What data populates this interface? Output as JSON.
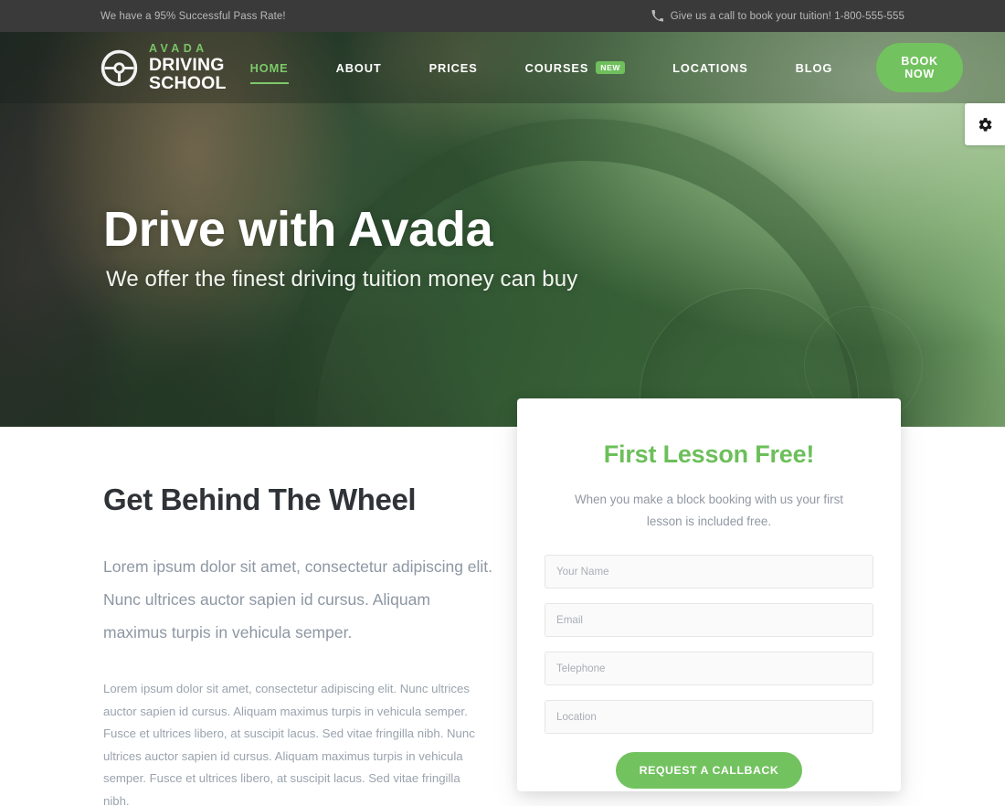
{
  "topbar": {
    "left_text": "We have a 95% Successful Pass Rate!",
    "phone_icon": "phone-icon",
    "right_text": "Give us a call to book your tuition! 1-800-555-555"
  },
  "header": {
    "logo": {
      "icon": "steering-wheel-icon",
      "top_line": "AVADA",
      "bottom_line": "DRIVING SCHOOL"
    },
    "nav": [
      {
        "label": "HOME",
        "active": true,
        "badge": ""
      },
      {
        "label": "ABOUT",
        "active": false,
        "badge": ""
      },
      {
        "label": "PRICES",
        "active": false,
        "badge": ""
      },
      {
        "label": "COURSES",
        "active": false,
        "badge": "NEW"
      },
      {
        "label": "LOCATIONS",
        "active": false,
        "badge": ""
      },
      {
        "label": "BLOG",
        "active": false,
        "badge": ""
      }
    ],
    "cta_label": "BOOK NOW"
  },
  "hero": {
    "title": "Drive with Avada",
    "subtitle": "We offer the finest driving tuition money can buy"
  },
  "settings_tab": {
    "icon": "gear-icon"
  },
  "main": {
    "section_title": "Get Behind The Wheel",
    "lead": "Lorem ipsum dolor sit amet, consectetur adipiscing elit. Nunc ultrices auctor sapien id cursus. Aliquam maximus turpis in vehicula semper.",
    "body": "Lorem ipsum dolor sit amet, consectetur adipiscing elit. Nunc ultrices auctor sapien id cursus. Aliquam maximus turpis in vehicula semper. Fusce et ultrices libero, at suscipit lacus. Sed vitae fringilla nibh. Nunc ultrices auctor sapien id cursus. Aliquam maximus turpis in vehicula semper. Fusce et ultrices libero, at suscipit lacus. Sed vitae fringilla nibh."
  },
  "form_card": {
    "title": "First Lesson Free!",
    "subtitle": "When you make a block booking with us your first lesson is included free.",
    "fields": [
      {
        "name": "your-name",
        "placeholder": "Your Name",
        "value": ""
      },
      {
        "name": "email",
        "placeholder": "Email",
        "value": ""
      },
      {
        "name": "telephone",
        "placeholder": "Telephone",
        "value": ""
      },
      {
        "name": "location",
        "placeholder": "Location",
        "value": ""
      }
    ],
    "submit_label": "REQUEST A CALLBACK"
  },
  "colors": {
    "brand_green": "#72c25f",
    "accent_green": "#6cbf5a",
    "logo_green": "#79c367",
    "topbar_bg": "#3a3a3a",
    "heading_dark": "#2f3338",
    "body_grey": "#9aa3ae"
  }
}
